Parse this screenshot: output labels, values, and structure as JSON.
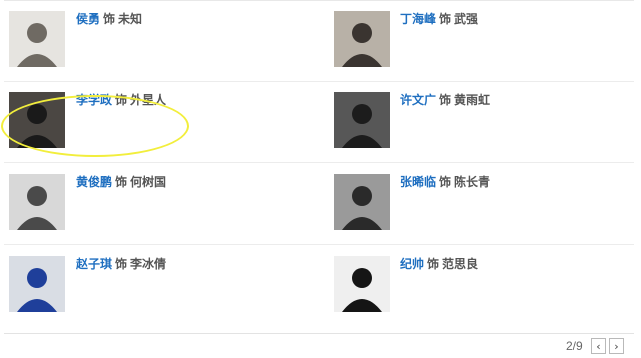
{
  "cast": [
    [
      {
        "name": "侯勇",
        "sep": "饰",
        "role": "未知",
        "photo_bg": "#e6e4e0",
        "photo_fg": "#6f6a63"
      },
      {
        "name": "丁海峰",
        "sep": "饰",
        "role": "武强",
        "photo_bg": "#b8b1a7",
        "photo_fg": "#3a3430"
      }
    ],
    [
      {
        "name": "李学政",
        "sep": "饰",
        "role": "外星人",
        "photo_bg": "#4b4743",
        "photo_fg": "#1a1a1a"
      },
      {
        "name": "许文广",
        "sep": "饰",
        "role": "黄雨虹",
        "photo_bg": "#575757",
        "photo_fg": "#1c1c1c"
      }
    ],
    [
      {
        "name": "黄俊鹏",
        "sep": "饰",
        "role": "何树国",
        "photo_bg": "#d8d8d8",
        "photo_fg": "#4a4a4a"
      },
      {
        "name": "张晞临",
        "sep": "饰",
        "role": "陈长青",
        "photo_bg": "#9a9a9a",
        "photo_fg": "#2a2a2a"
      }
    ],
    [
      {
        "name": "赵子琪",
        "sep": "饰",
        "role": "李冰倩",
        "photo_bg": "#d9dde4",
        "photo_fg": "#1f3f9a"
      },
      {
        "name": "纪帅",
        "sep": "饰",
        "role": "范思良",
        "photo_bg": "#efefef",
        "photo_fg": "#151515"
      }
    ]
  ],
  "pager": {
    "text": "2/9",
    "prev_glyph": "‹",
    "next_glyph": "›"
  },
  "colors": {
    "name_link": "#1f6fc0",
    "highlight": "#f2ee3c"
  }
}
